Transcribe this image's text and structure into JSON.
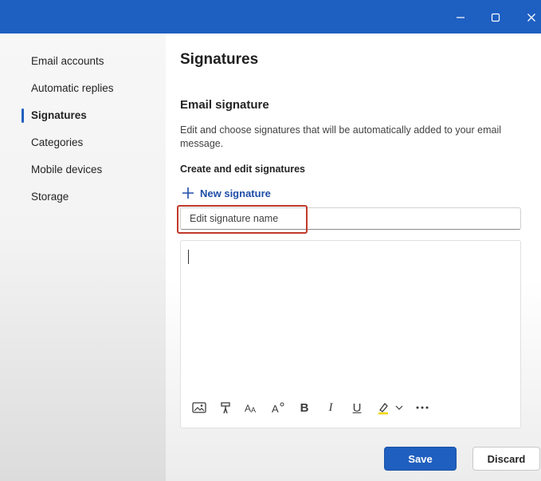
{
  "window": {
    "controls": [
      "minimize-icon",
      "maximize-icon",
      "close-icon"
    ],
    "titlebar_color": "#1e5fc2"
  },
  "sidebar": {
    "items": [
      {
        "label": "Email accounts",
        "active": false
      },
      {
        "label": "Automatic replies",
        "active": false
      },
      {
        "label": "Signatures",
        "active": true
      },
      {
        "label": "Categories",
        "active": false
      },
      {
        "label": "Mobile devices",
        "active": false
      },
      {
        "label": "Storage",
        "active": false
      }
    ]
  },
  "main": {
    "title": "Signatures",
    "section_title": "Email signature",
    "description": "Edit and choose signatures that will be automatically added to your email message.",
    "subheading": "Create and edit signatures",
    "new_signature_label": "New signature",
    "name_field": {
      "value": "",
      "placeholder": "Edit signature name"
    },
    "editor_toolbar": [
      "image-icon",
      "format-painter-icon",
      "font-size-icon",
      "superscript-icon",
      "bold-icon",
      "italic-icon",
      "underline-icon",
      "highlight-icon",
      "chevron-down-icon",
      "more-icon"
    ],
    "toolbar_glyphs": {
      "bold": "B",
      "italic": "I",
      "underline": "U"
    },
    "save_label": "Save",
    "discard_label": "Discard"
  },
  "colors": {
    "accent": "#1f5fbf",
    "highlight_box": "#c0392b",
    "highlighter": "#f2d600"
  }
}
